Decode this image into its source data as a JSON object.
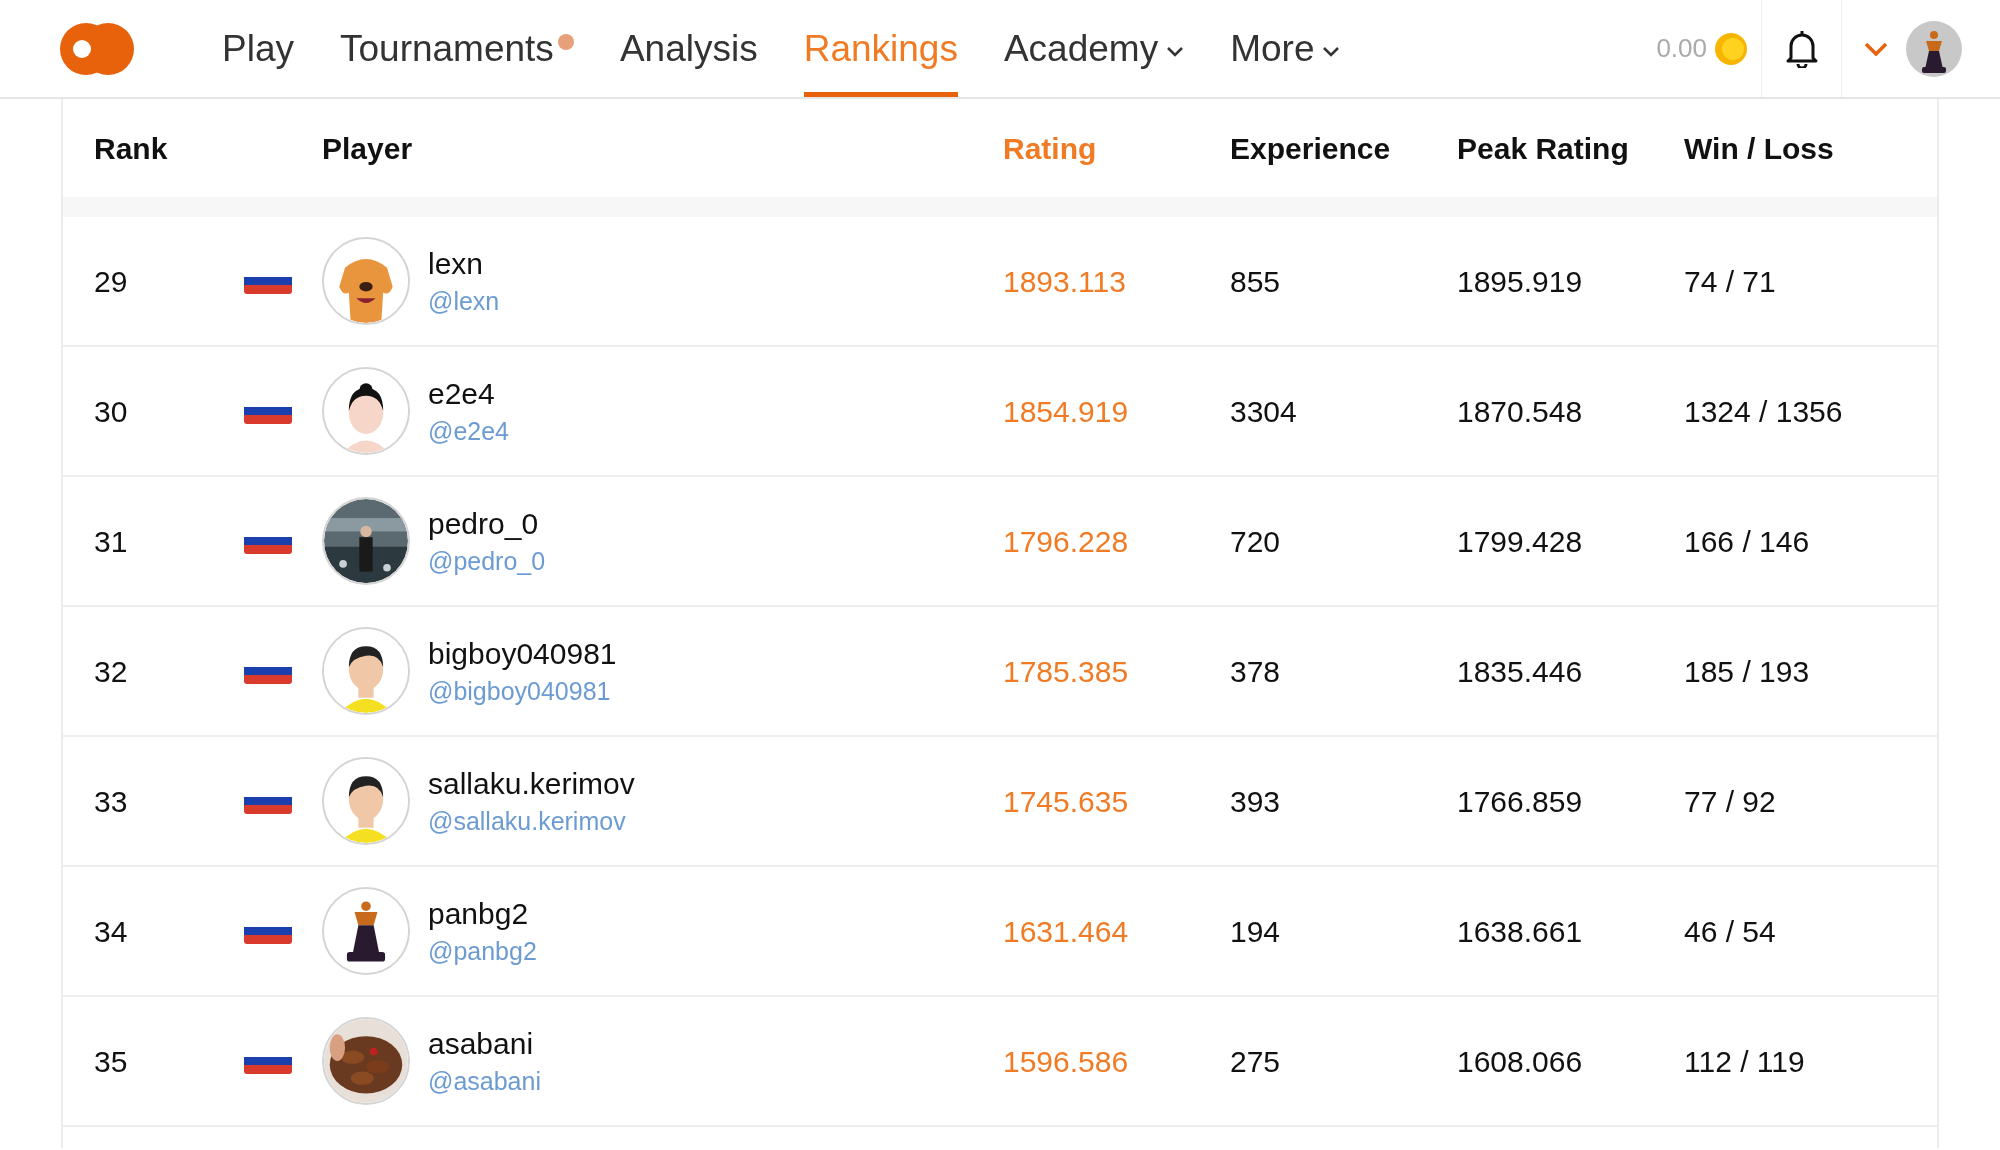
{
  "nav": {
    "items": [
      {
        "label": "Play",
        "selected": false,
        "dropdown": false,
        "dot": false
      },
      {
        "label": "Tournaments",
        "selected": false,
        "dropdown": false,
        "dot": true
      },
      {
        "label": "Analysis",
        "selected": false,
        "dropdown": false,
        "dot": false
      },
      {
        "label": "Rankings",
        "selected": true,
        "dropdown": false,
        "dot": false
      },
      {
        "label": "Academy",
        "selected": false,
        "dropdown": true,
        "dot": false
      },
      {
        "label": "More",
        "selected": false,
        "dropdown": true,
        "dot": false
      }
    ],
    "balance": "0.00"
  },
  "table": {
    "columns": [
      {
        "label": "Rank",
        "selected": false
      },
      {
        "label": "Player",
        "selected": false
      },
      {
        "label": "Rating",
        "selected": true
      },
      {
        "label": "Experience",
        "selected": false
      },
      {
        "label": "Peak Rating",
        "selected": false
      },
      {
        "label": "Win / Loss",
        "selected": false
      }
    ],
    "rows": [
      {
        "rank": "29",
        "name": "lexn",
        "handle": "@lexn",
        "rating": "1893.113",
        "experience": "855",
        "peak": "1895.919",
        "win_loss": "74 / 71"
      },
      {
        "rank": "30",
        "name": "e2e4",
        "handle": "@e2e4",
        "rating": "1854.919",
        "experience": "3304",
        "peak": "1870.548",
        "win_loss": "1324 / 1356"
      },
      {
        "rank": "31",
        "name": "pedro_0",
        "handle": "@pedro_0",
        "rating": "1796.228",
        "experience": "720",
        "peak": "1799.428",
        "win_loss": "166 / 146"
      },
      {
        "rank": "32",
        "name": "bigboy040981",
        "handle": "@bigboy040981",
        "rating": "1785.385",
        "experience": "378",
        "peak": "1835.446",
        "win_loss": "185 / 193"
      },
      {
        "rank": "33",
        "name": "sallaku.kerimov",
        "handle": "@sallaku.kerimov",
        "rating": "1745.635",
        "experience": "393",
        "peak": "1766.859",
        "win_loss": "77 / 92"
      },
      {
        "rank": "34",
        "name": "panbg2",
        "handle": "@panbg2",
        "rating": "1631.464",
        "experience": "194",
        "peak": "1638.661",
        "win_loss": "46 / 54"
      },
      {
        "rank": "35",
        "name": "asabani",
        "handle": "@asabani",
        "rating": "1596.586",
        "experience": "275",
        "peak": "1608.066",
        "win_loss": "112 / 119"
      }
    ]
  }
}
